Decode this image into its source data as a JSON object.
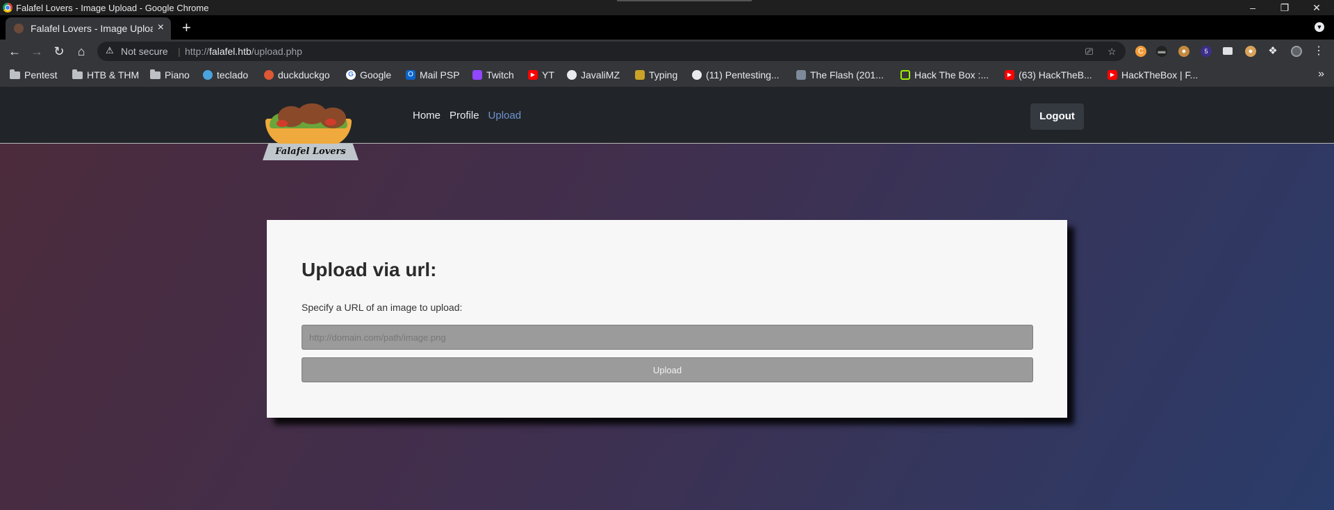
{
  "window": {
    "title": "Falafel Lovers - Image Upload - Google Chrome",
    "minimize": "–",
    "restore": "❐",
    "close": "✕"
  },
  "tabs": [
    {
      "title": "Falafel Lovers - Image Upload",
      "close": "×"
    }
  ],
  "toolbar": {
    "back": "←",
    "forward": "→",
    "reload": "↻",
    "home": "⌂",
    "security_label": "Not secure",
    "url_scheme": "http://",
    "url_host": "falafel.htb",
    "url_path": "/upload.php",
    "new_tab": "+",
    "extension_badge": "5"
  },
  "bookmarks": [
    {
      "label": "Pentest",
      "icon": "folder-icon"
    },
    {
      "label": "HTB & THM",
      "icon": "folder-icon"
    },
    {
      "label": "Piano",
      "icon": "folder-icon"
    },
    {
      "label": "teclado",
      "icon": "teclado-icon",
      "color": "#4aa3df"
    },
    {
      "label": "duckduckgo",
      "icon": "duckduckgo-icon",
      "color": "#de5833"
    },
    {
      "label": "Google",
      "icon": "google-icon",
      "color": "#4285f4"
    },
    {
      "label": "Mail PSP",
      "icon": "outlook-icon",
      "color": "#0a64c9"
    },
    {
      "label": "Twitch",
      "icon": "twitch-icon",
      "color": "#9146ff"
    },
    {
      "label": "YT",
      "icon": "youtube-icon",
      "color": "#ff0000"
    },
    {
      "label": "JavaliMZ",
      "icon": "github-icon",
      "color": "#e8eaed"
    },
    {
      "label": "Typing",
      "icon": "typing-icon",
      "color": "#c9a227"
    },
    {
      "label": "(11) Pentesting...",
      "icon": "globe-icon",
      "color": "#e8eaed"
    },
    {
      "label": "The Flash (201...",
      "icon": "imdb-icon",
      "color": "#7d8a99"
    },
    {
      "label": "Hack The Box :...",
      "icon": "htb-icon",
      "color": "#9fef00"
    },
    {
      "label": "(63) HackTheB...",
      "icon": "youtube-icon",
      "color": "#ff0000"
    },
    {
      "label": "HackTheBox | F...",
      "icon": "youtube-icon",
      "color": "#ff0000"
    }
  ],
  "bookmarks_more": "»",
  "site": {
    "logo_text": "Falafel Lovers",
    "nav": [
      {
        "label": "Home",
        "active": false
      },
      {
        "label": "Profile",
        "active": false
      },
      {
        "label": "Upload",
        "active": true
      }
    ],
    "logout_label": "Logout"
  },
  "upload": {
    "heading": "Upload via url:",
    "description": "Specify a URL of an image to upload:",
    "placeholder": "http://domain.com/path/image.png",
    "button_label": "Upload"
  },
  "colors": {
    "nav_active": "#6f93d0",
    "header_bg": "#212529",
    "card_bg": "#f7f7f7"
  }
}
